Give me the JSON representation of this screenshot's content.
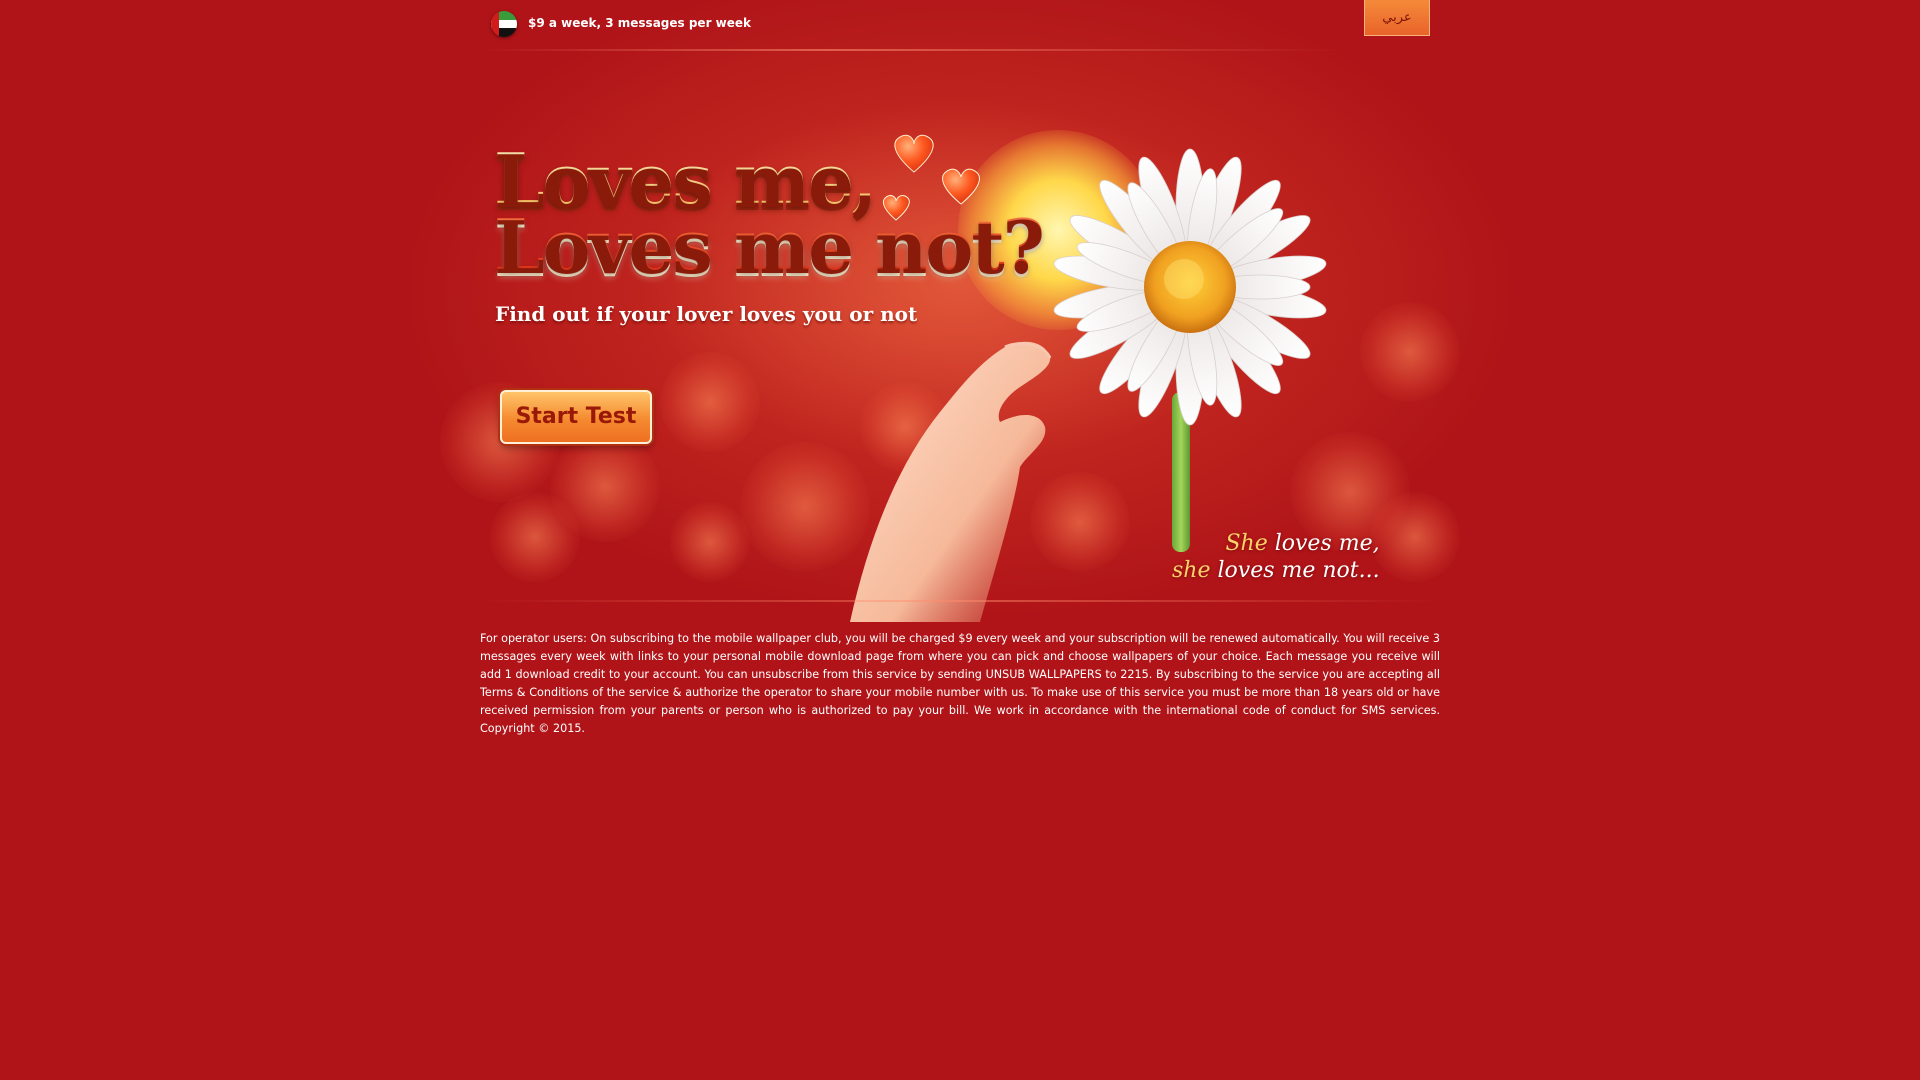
{
  "topbar": {
    "flag_icon": "uae-flag-icon",
    "price_text": "$9 a week, 3 messages per week",
    "language_button": "عربي"
  },
  "hero": {
    "title_line_1": "Loves me,",
    "title_line_2": "Loves me not?",
    "subtitle": "Find out if your lover loves you or not",
    "start_button": "Start Test",
    "caption": {
      "line1_accent": "She",
      "line1_rest": " loves me,",
      "line2_accent": "she",
      "line2_rest": " loves me not..."
    },
    "icons": [
      "hearts-icon",
      "daisy-icon",
      "hand-icon",
      "sun-icon"
    ]
  },
  "footer": {
    "disclaimer": "For operator users: On subscribing to the mobile wallpaper club, you will be charged $9 every week and your subscription will be renewed automatically. You will receive 3 messages every week with links to your personal mobile download page from where you can pick and choose wallpapers of your choice. Each message you receive will add 1 download credit to your account. You can unsubscribe from this service by sending UNSUB WALLPAPERS to 2215. By subscribing to the service you are accepting all Terms & Conditions of the service & authorize the operator to share your mobile number with us. To make use of this service you must be more than 18 years old or have received permission from your parents or person who is authorized to pay your bill. We work in accordance with the international code of conduct for SMS services. Copyright © 2015."
  },
  "colors": {
    "background": "#b01418",
    "button_orange": "#f58a30",
    "title_yellow": "#ffd98a",
    "title_red": "#ff5a2a"
  }
}
